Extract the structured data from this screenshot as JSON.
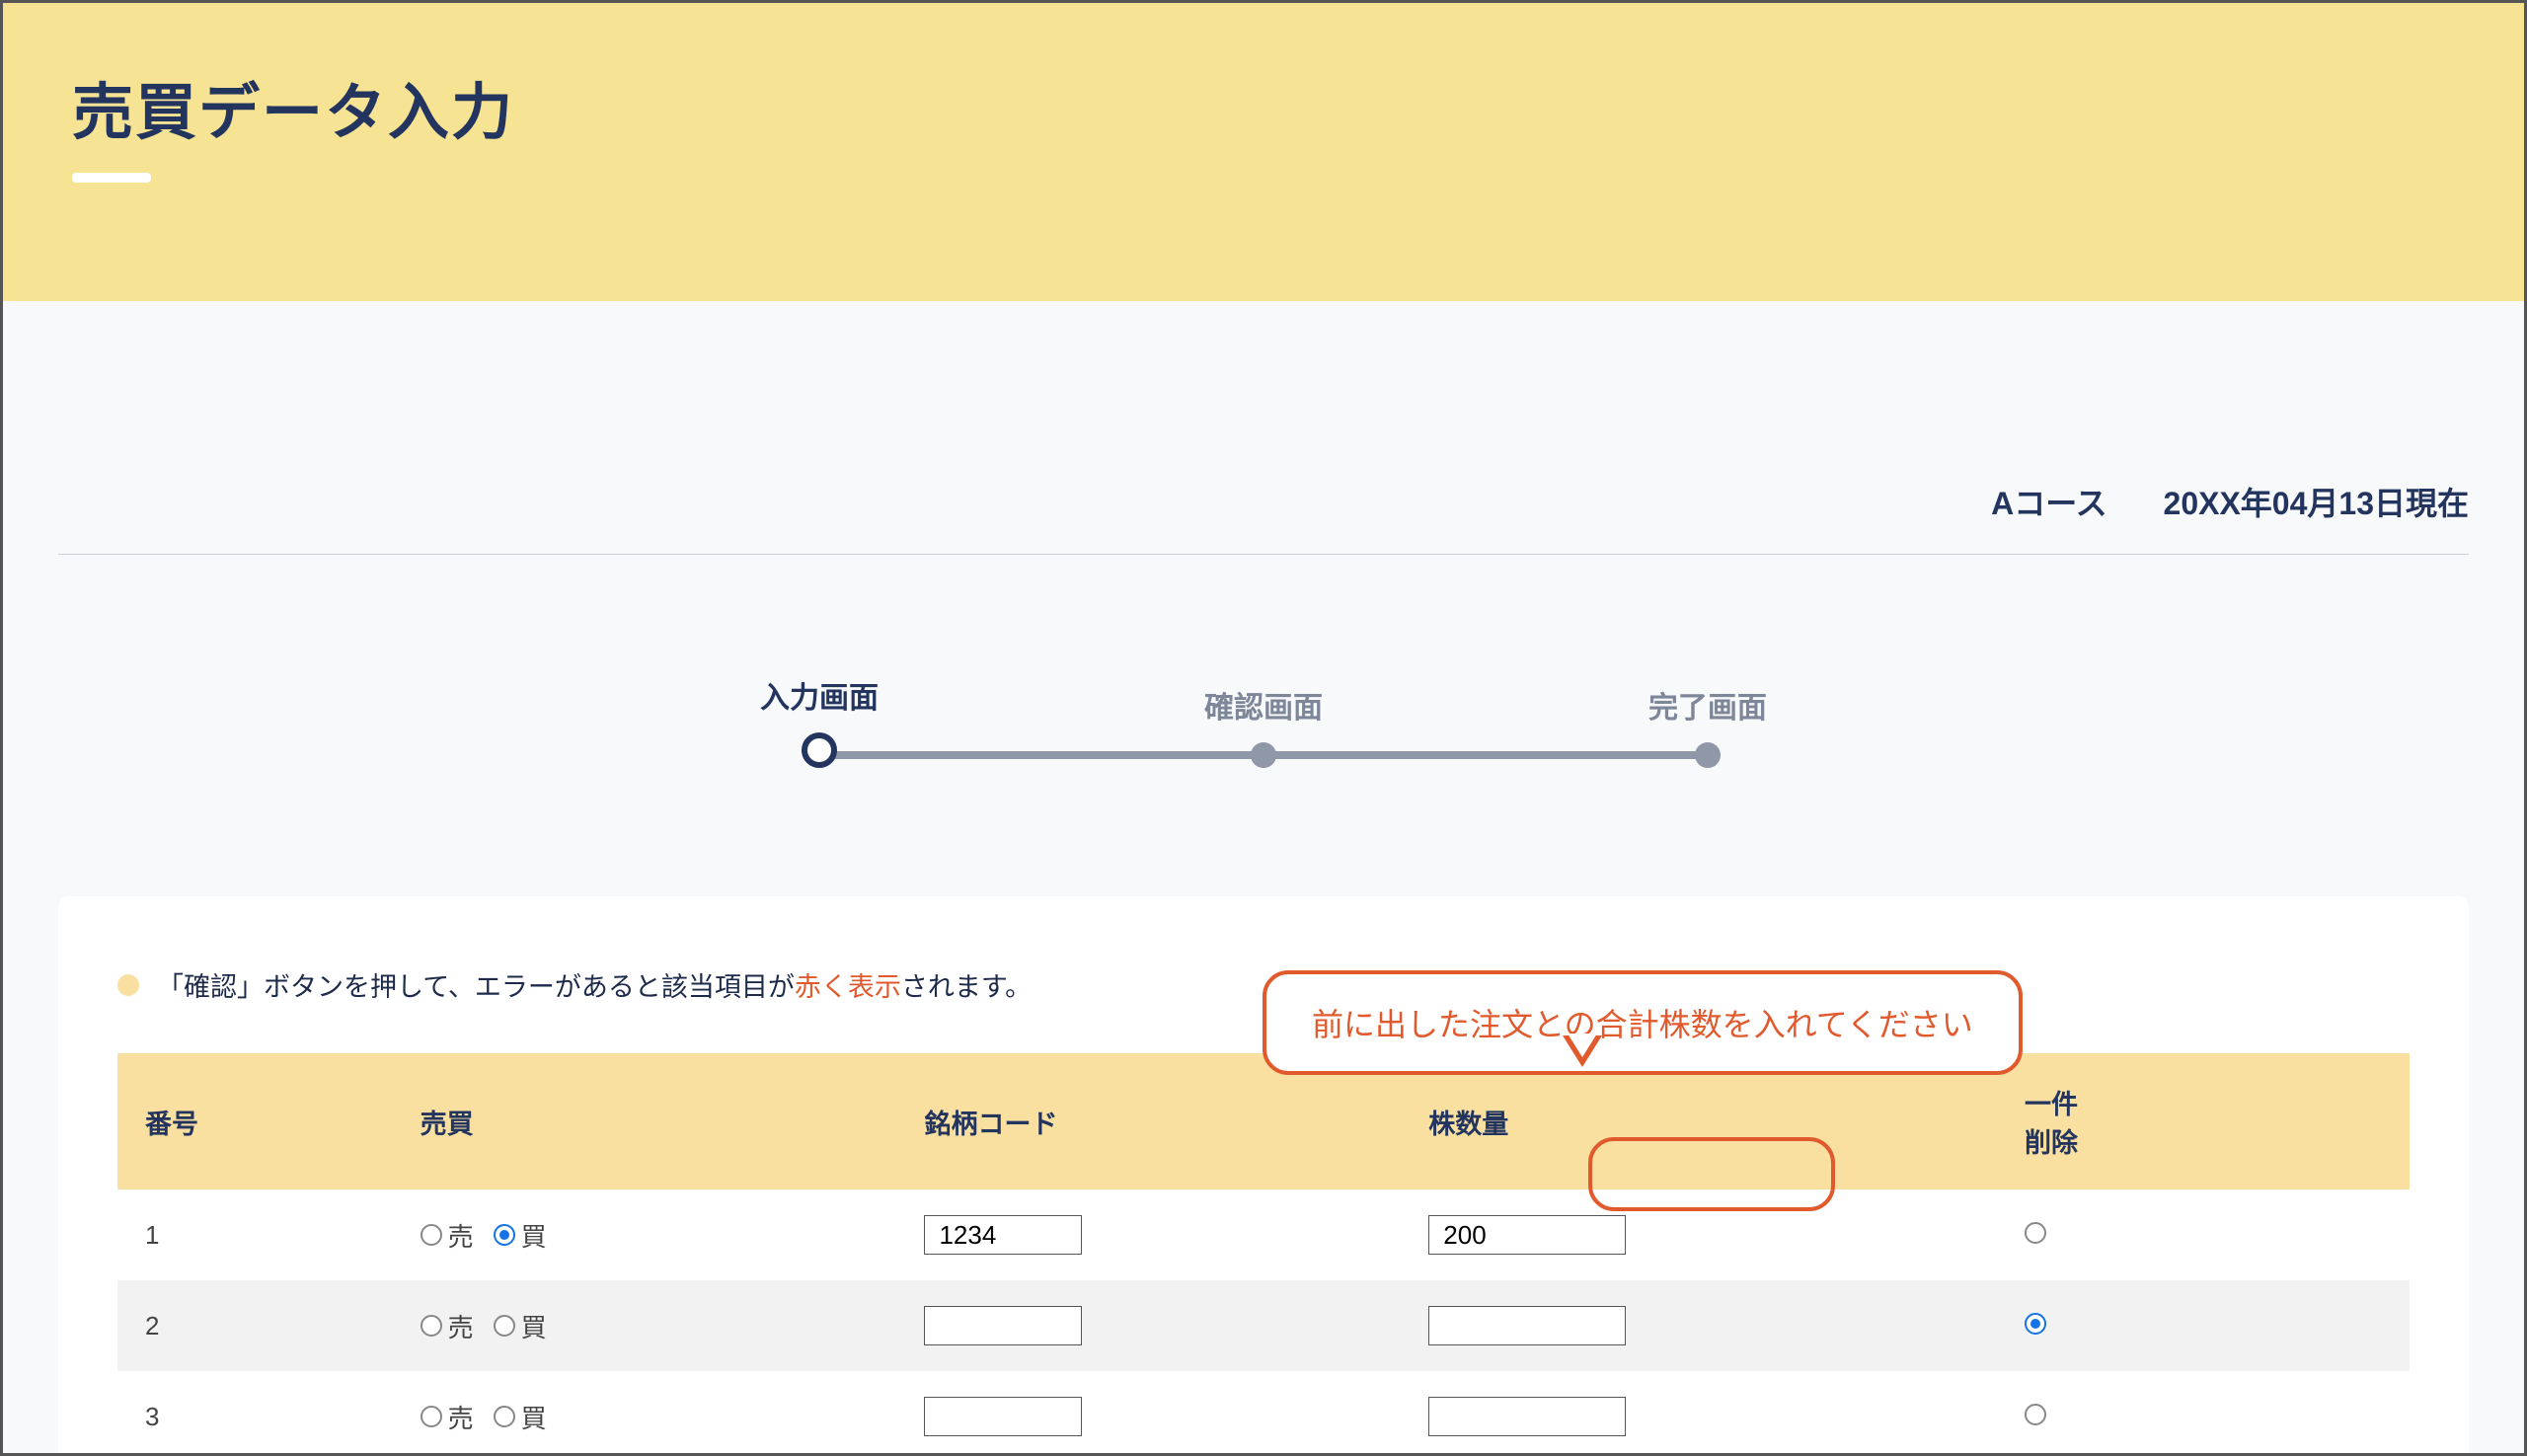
{
  "page_title": "売買データ入力",
  "subheader": {
    "course": "Aコース",
    "asof": "20XX年04月13日現在"
  },
  "stepper": {
    "steps": [
      {
        "label": "入力画面",
        "active": true
      },
      {
        "label": "確認画面",
        "active": false
      },
      {
        "label": "完了画面",
        "active": false
      }
    ]
  },
  "notice": {
    "prefix": "「確認」ボタンを押して、エラーがあると該当項目が",
    "highlight": "赤く表示",
    "suffix": "されます。"
  },
  "table": {
    "headers": {
      "no": "番号",
      "side": "売買",
      "code": "銘柄コード",
      "qty": "株数量",
      "delete": "一件\n削除"
    },
    "side_labels": {
      "sell": "売",
      "buy": "買"
    },
    "rows": [
      {
        "no": "1",
        "side_selected": "buy",
        "code": "1234",
        "qty": "200",
        "delete_selected": false
      },
      {
        "no": "2",
        "side_selected": null,
        "code": "",
        "qty": "",
        "delete_selected": true
      },
      {
        "no": "3",
        "side_selected": null,
        "code": "",
        "qty": "",
        "delete_selected": false
      }
    ]
  },
  "callout": {
    "text": "前に出した注文との合計株数を入れてください"
  }
}
